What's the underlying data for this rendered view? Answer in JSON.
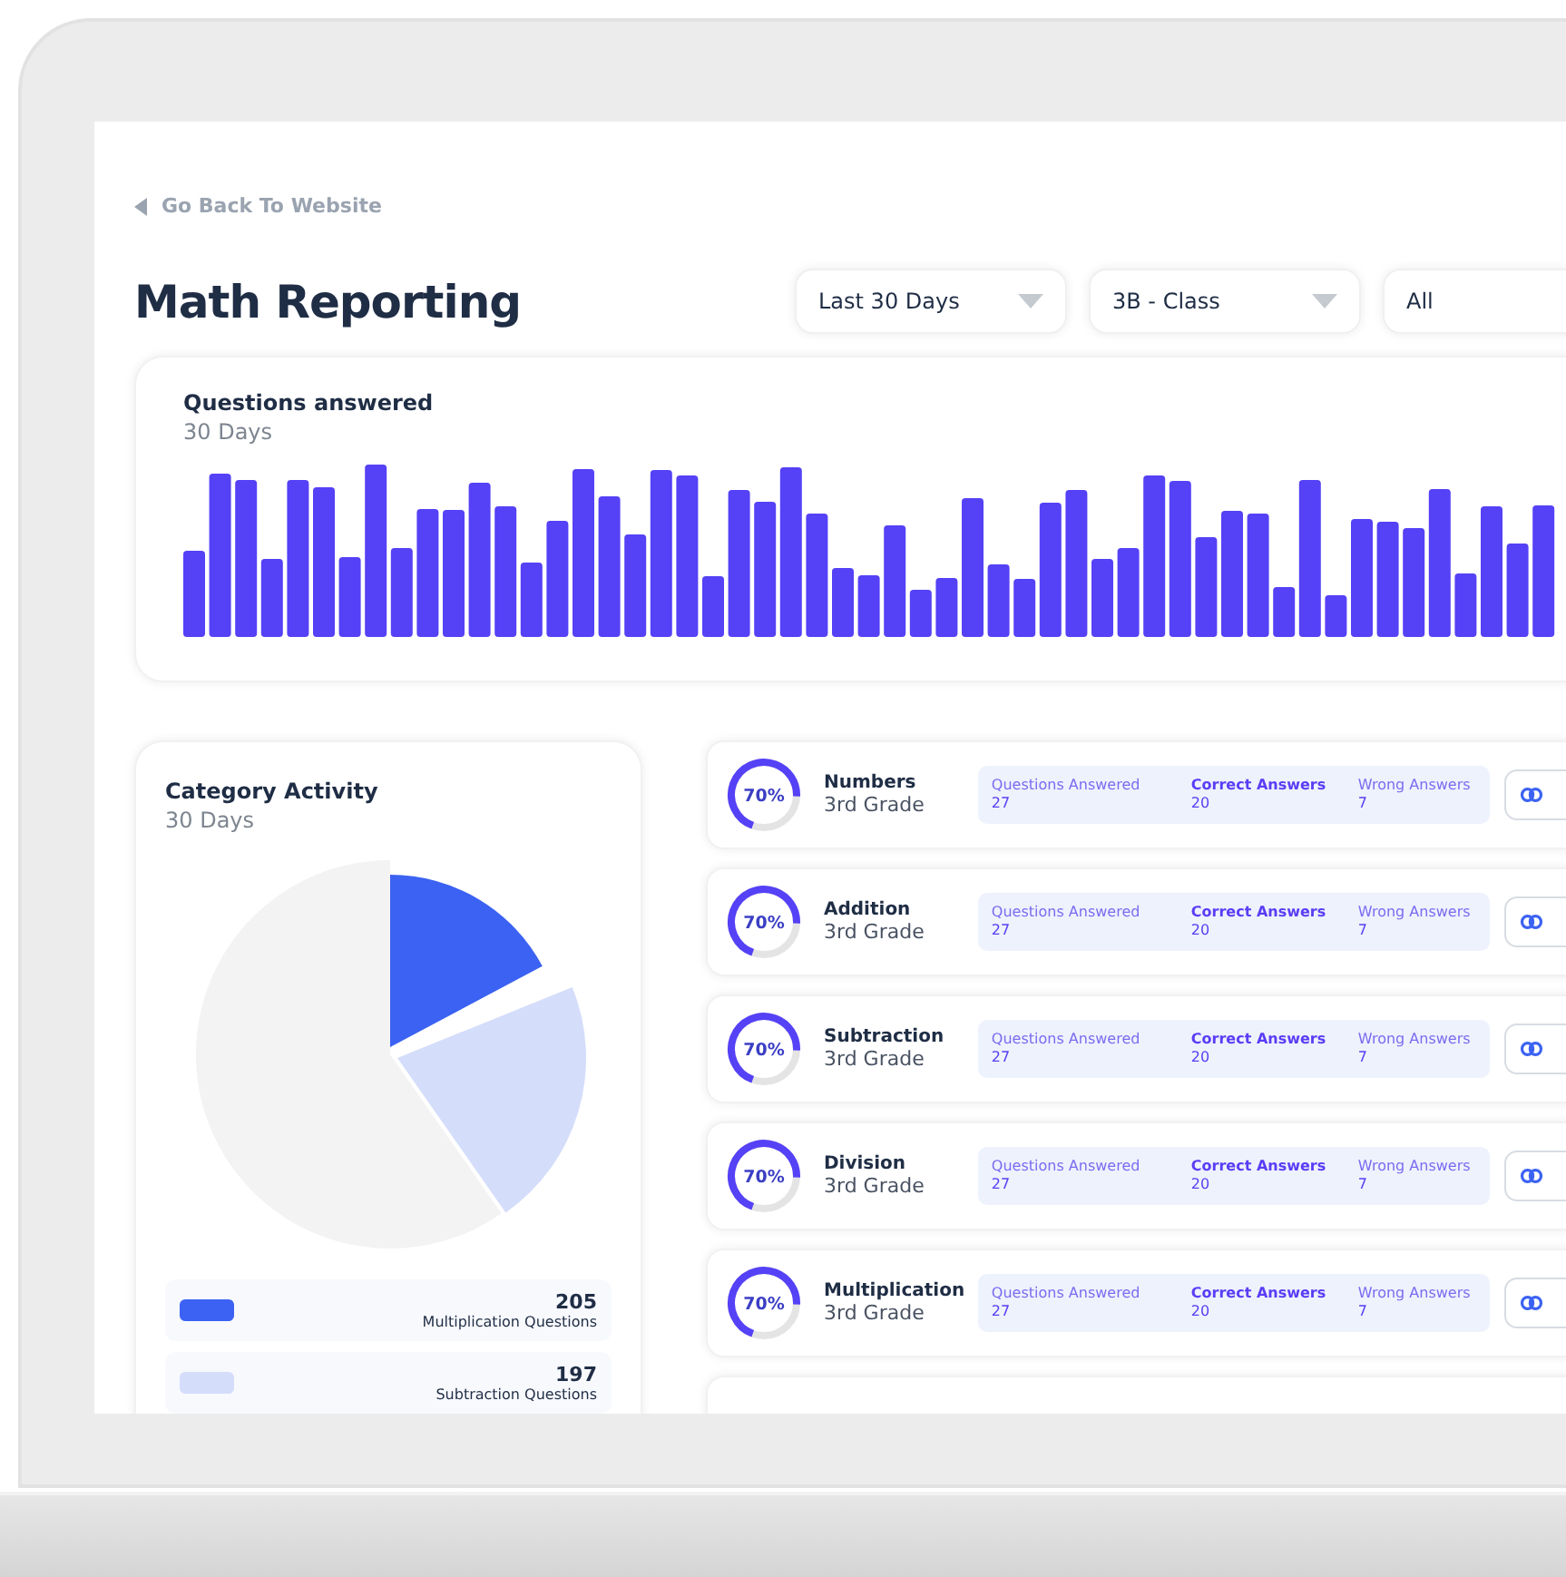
{
  "back_link": {
    "label": "Go Back To Website"
  },
  "title": "Math Reporting",
  "filters": [
    {
      "value": "Last 30 Days"
    },
    {
      "value": "3B - Class"
    },
    {
      "value": "All"
    }
  ],
  "questions_chart": {
    "title": "Questions answered",
    "subtitle": "30 Days"
  },
  "category_activity": {
    "title": "Category Activity",
    "subtitle": "30 Days",
    "legend": [
      {
        "value": "205",
        "label": "Multiplication Questions",
        "color": "#3b62f2"
      },
      {
        "value": "197",
        "label": "Subtraction Questions",
        "color": "#d4ddfa"
      }
    ]
  },
  "categories": [
    {
      "name": "Numbers",
      "grade": "3rd Grade",
      "percent": "70%",
      "level": 0.7,
      "stats": [
        {
          "label": "Questions Answered",
          "value": "27"
        },
        {
          "label": "Correct Answers",
          "value": "20"
        },
        {
          "label": "Wrong Answers",
          "value": "7"
        }
      ]
    },
    {
      "name": "Addition",
      "grade": "3rd Grade",
      "percent": "70%",
      "level": 0.7,
      "stats": [
        {
          "label": "Questions Answered",
          "value": "27"
        },
        {
          "label": "Correct Answers",
          "value": "20"
        },
        {
          "label": "Wrong Answers",
          "value": "7"
        }
      ]
    },
    {
      "name": "Subtraction",
      "grade": "3rd Grade",
      "percent": "70%",
      "level": 0.7,
      "stats": [
        {
          "label": "Questions Answered",
          "value": "27"
        },
        {
          "label": "Correct Answers",
          "value": "20"
        },
        {
          "label": "Wrong Answers",
          "value": "7"
        }
      ]
    },
    {
      "name": "Division",
      "grade": "3rd Grade",
      "percent": "70%",
      "level": 0.7,
      "stats": [
        {
          "label": "Questions Answered",
          "value": "27"
        },
        {
          "label": "Correct Answers",
          "value": "20"
        },
        {
          "label": "Wrong Answers",
          "value": "7"
        }
      ]
    },
    {
      "name": "Multiplication",
      "grade": "3rd Grade",
      "percent": "70%",
      "level": 0.7,
      "stats": [
        {
          "label": "Questions Answered",
          "value": "27"
        },
        {
          "label": "Correct Answers",
          "value": "20"
        },
        {
          "label": "Wrong Answers",
          "value": "7"
        }
      ]
    }
  ]
}
